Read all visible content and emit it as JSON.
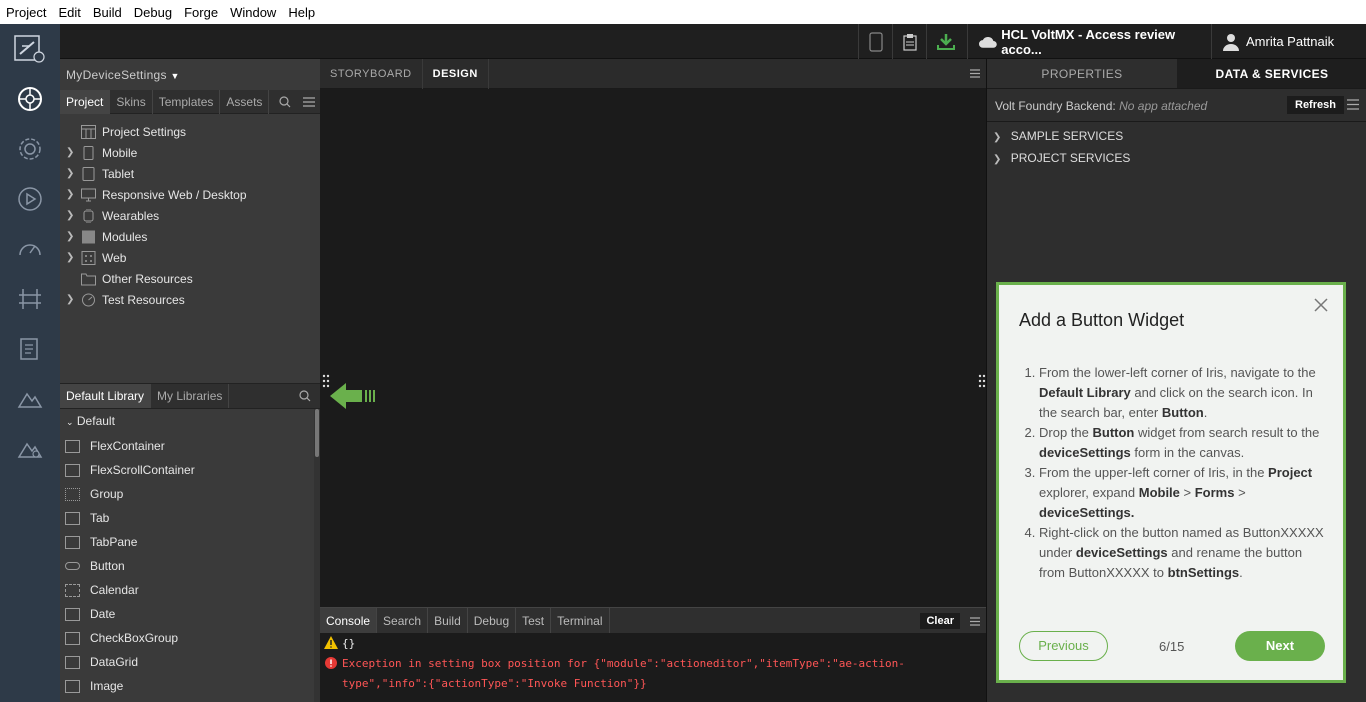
{
  "menu": [
    "Project",
    "Edit",
    "Build",
    "Debug",
    "Forge",
    "Window",
    "Help"
  ],
  "toolbar": {
    "account": "HCL VoltMX - Access review acco...",
    "user": "Amrita Pattnaik"
  },
  "left_panel": {
    "project_name": "MyDeviceSettings",
    "tabs": [
      "Project",
      "Skins",
      "Templates",
      "Assets"
    ],
    "tree": [
      {
        "label": "Project Settings",
        "expandable": false
      },
      {
        "label": "Mobile",
        "expandable": true
      },
      {
        "label": "Tablet",
        "expandable": true
      },
      {
        "label": "Responsive Web / Desktop",
        "expandable": true
      },
      {
        "label": "Wearables",
        "expandable": true
      },
      {
        "label": "Modules",
        "expandable": true
      },
      {
        "label": "Web",
        "expandable": true
      },
      {
        "label": "Other Resources",
        "expandable": false
      },
      {
        "label": "Test Resources",
        "expandable": true
      }
    ],
    "lib_tabs": [
      "Default Library",
      "My Libraries"
    ],
    "lib_group": "Default",
    "lib_items": [
      "FlexContainer",
      "FlexScrollContainer",
      "Group",
      "Tab",
      "TabPane",
      "Button",
      "Calendar",
      "Date",
      "CheckBoxGroup",
      "DataGrid",
      "Image"
    ]
  },
  "center": {
    "tabs": [
      "STORYBOARD",
      "DESIGN"
    ],
    "console_tabs": [
      "Console",
      "Search",
      "Build",
      "Debug",
      "Test",
      "Terminal"
    ],
    "clear_label": "Clear",
    "console_warn": "{}",
    "console_err_1": "Exception in setting box position for {\"module\":\"actioneditor\",\"itemType\":\"ae-action-",
    "console_err_2": "type\",\"info\":{\"actionType\":\"Invoke Function\"}}"
  },
  "right_panel": {
    "tabs": [
      "PROPERTIES",
      "DATA & SERVICES"
    ],
    "backend_label": "Volt Foundry Backend:",
    "backend_value": "No app attached",
    "refresh_label": "Refresh",
    "services": [
      "SAMPLE SERVICES",
      "PROJECT SERVICES"
    ]
  },
  "dialog": {
    "title": "Add a Button Widget",
    "prev_label": "Previous",
    "next_label": "Next",
    "pager": "6/15",
    "step1_a": "From the lower-left corner of Iris, navigate to the ",
    "step1_b": "Default Library",
    "step1_c": " and click on the search icon. In the search bar, enter ",
    "step1_d": "Button",
    "step1_e": ".",
    "step2_a": "Drop the ",
    "step2_b": "Button",
    "step2_c": " widget from search result to the ",
    "step2_d": "deviceSettings",
    "step2_e": " form in the canvas.",
    "step3_a": "From the upper-left corner of Iris, in the ",
    "step3_b": "Project",
    "step3_c": " explorer, expand ",
    "step3_d": "Mobile",
    "step3_e": " > ",
    "step3_f": "Forms",
    "step3_g": " > ",
    "step3_h": "deviceSettings.",
    "step4_a": "Right-click on the button named as ButtonXXXXX under ",
    "step4_b": "deviceSettings",
    "step4_c": " and rename the button from ButtonXXXXX to ",
    "step4_d": "btnSettings",
    "step4_e": "."
  },
  "colors": {
    "accent_green": "#6ab04c",
    "error_red": "#ff5656",
    "sidebar": "#2e3a48"
  }
}
